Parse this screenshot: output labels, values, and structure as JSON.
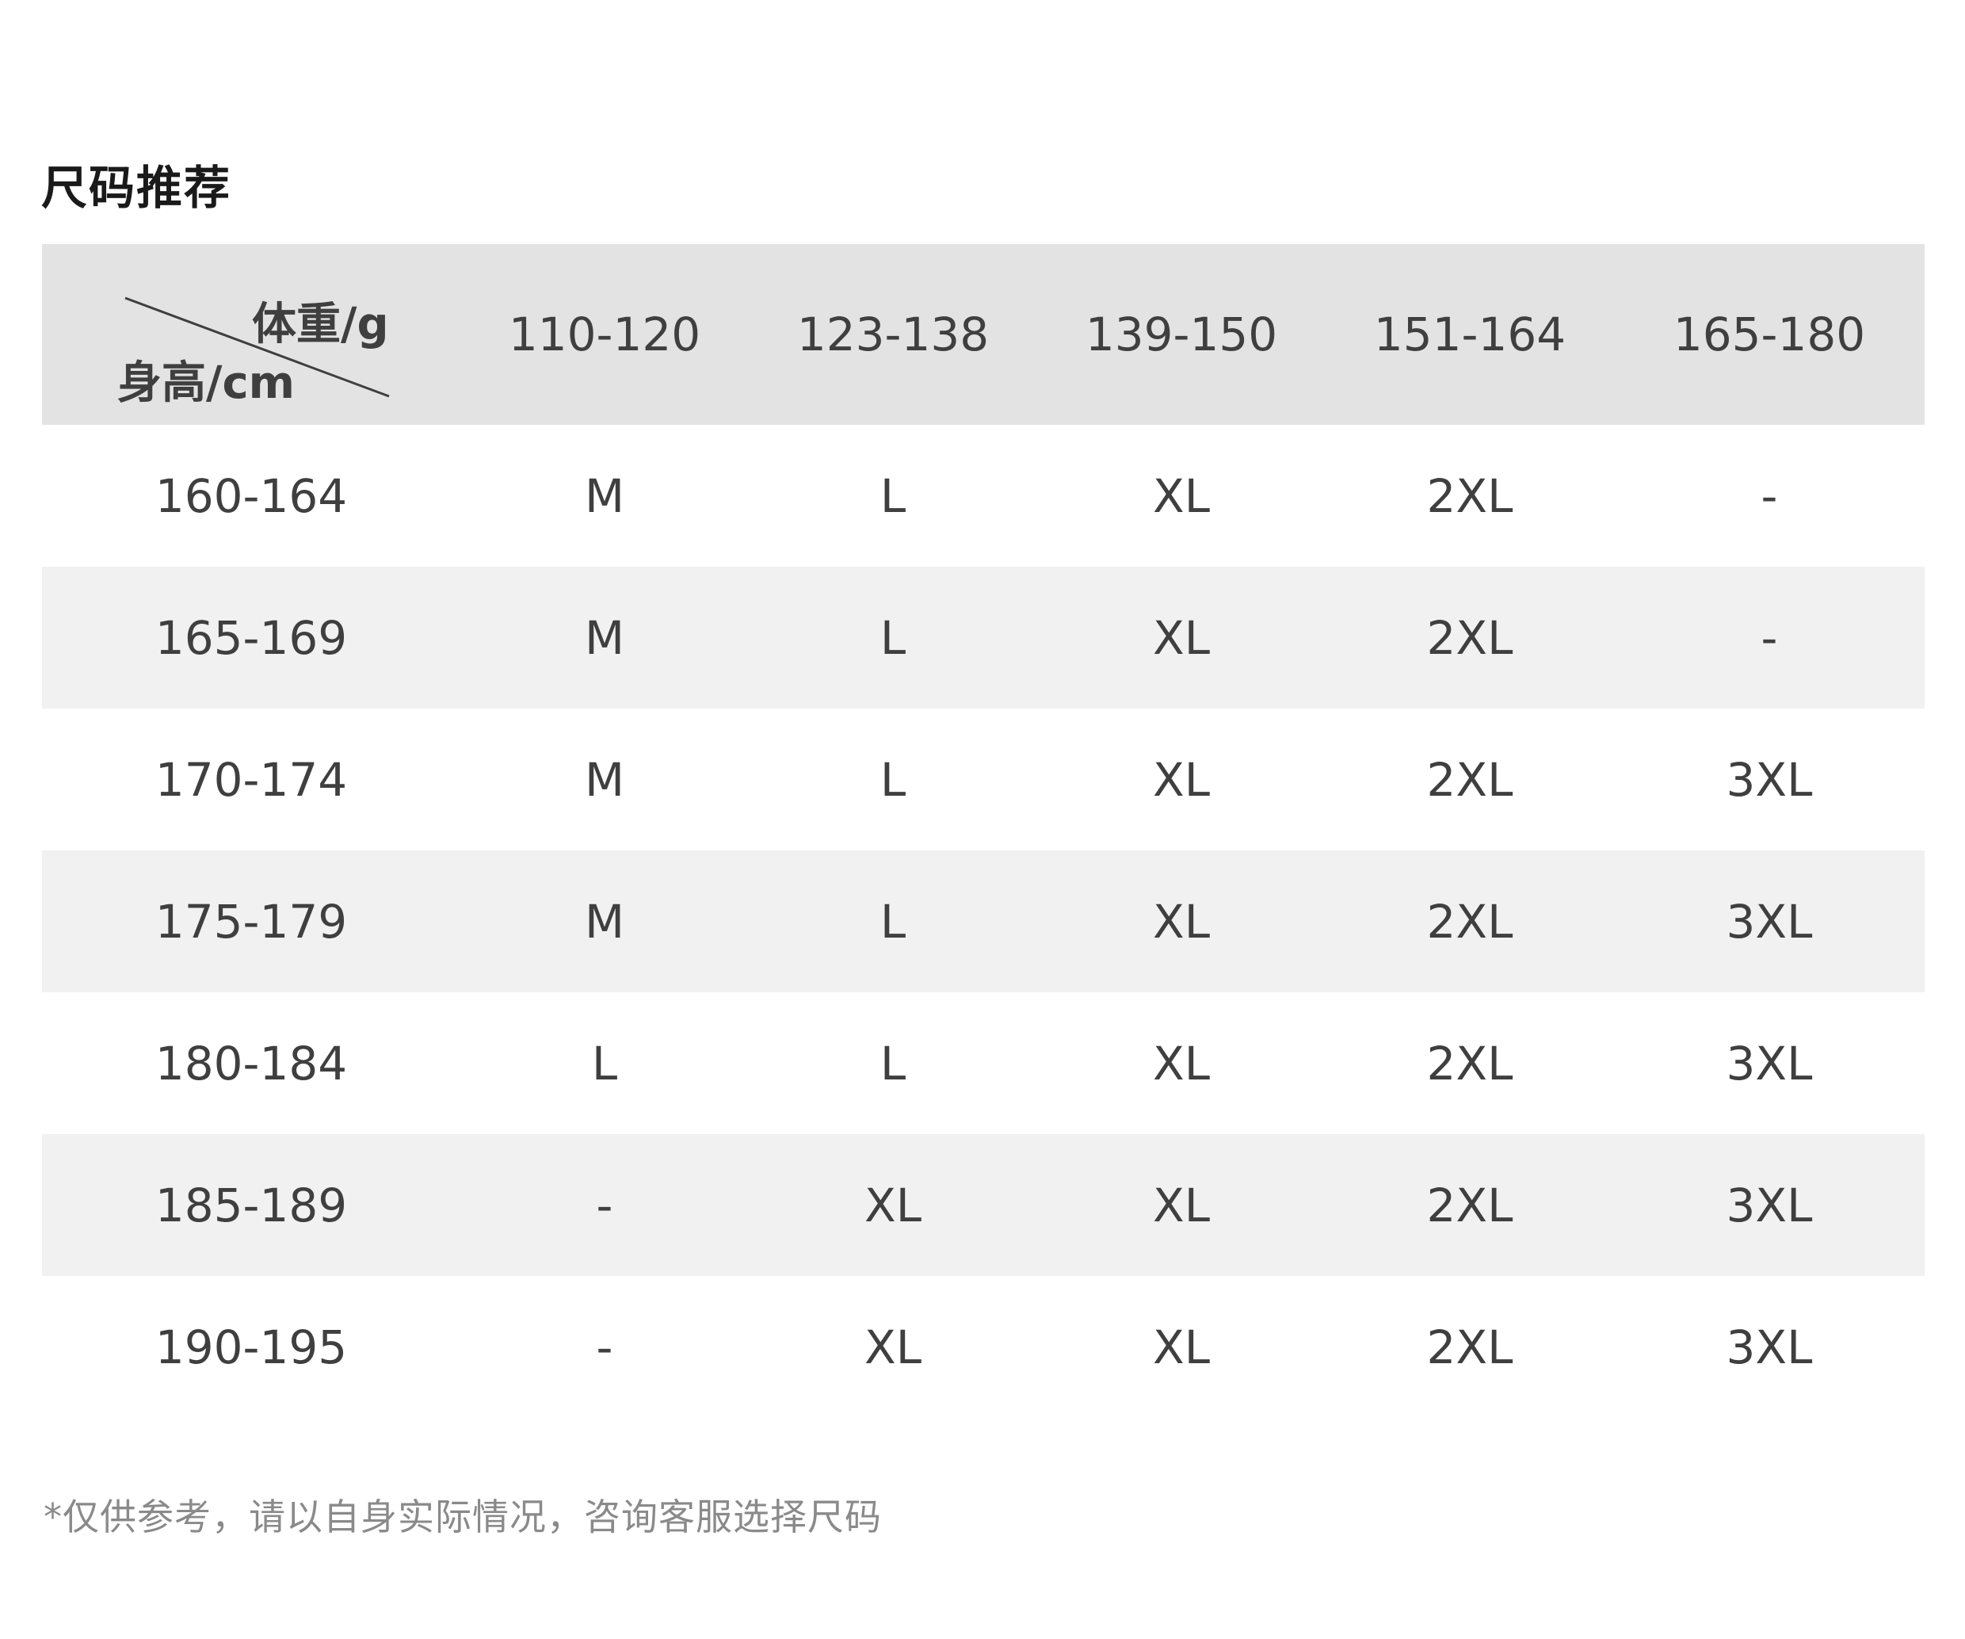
{
  "title": "尺码推荐",
  "header": {
    "weight_label": "体重/g",
    "height_label": "身高/cm",
    "weight_ranges": [
      "110-120",
      "123-138",
      "139-150",
      "151-164",
      "165-180"
    ]
  },
  "rows": [
    {
      "height": "160-164",
      "sizes": [
        "M",
        "L",
        "XL",
        "2XL",
        "-"
      ]
    },
    {
      "height": "165-169",
      "sizes": [
        "M",
        "L",
        "XL",
        "2XL",
        "-"
      ]
    },
    {
      "height": "170-174",
      "sizes": [
        "M",
        "L",
        "XL",
        "2XL",
        "3XL"
      ]
    },
    {
      "height": "175-179",
      "sizes": [
        "M",
        "L",
        "XL",
        "2XL",
        "3XL"
      ]
    },
    {
      "height": "180-184",
      "sizes": [
        "L",
        "L",
        "XL",
        "2XL",
        "3XL"
      ]
    },
    {
      "height": "185-189",
      "sizes": [
        "-",
        "XL",
        "XL",
        "2XL",
        "3XL"
      ]
    },
    {
      "height": "190-195",
      "sizes": [
        "-",
        "XL",
        "XL",
        "2XL",
        "3XL"
      ]
    }
  ],
  "footnote": "*仅供参考，请以自身实际情况，咨询客服选择尺码",
  "colors": {
    "header_bg": "#e3e3e3",
    "stripe_bg": "#f1f1f1",
    "text": "#3f3f3f",
    "footnote": "#8a8a8a"
  }
}
